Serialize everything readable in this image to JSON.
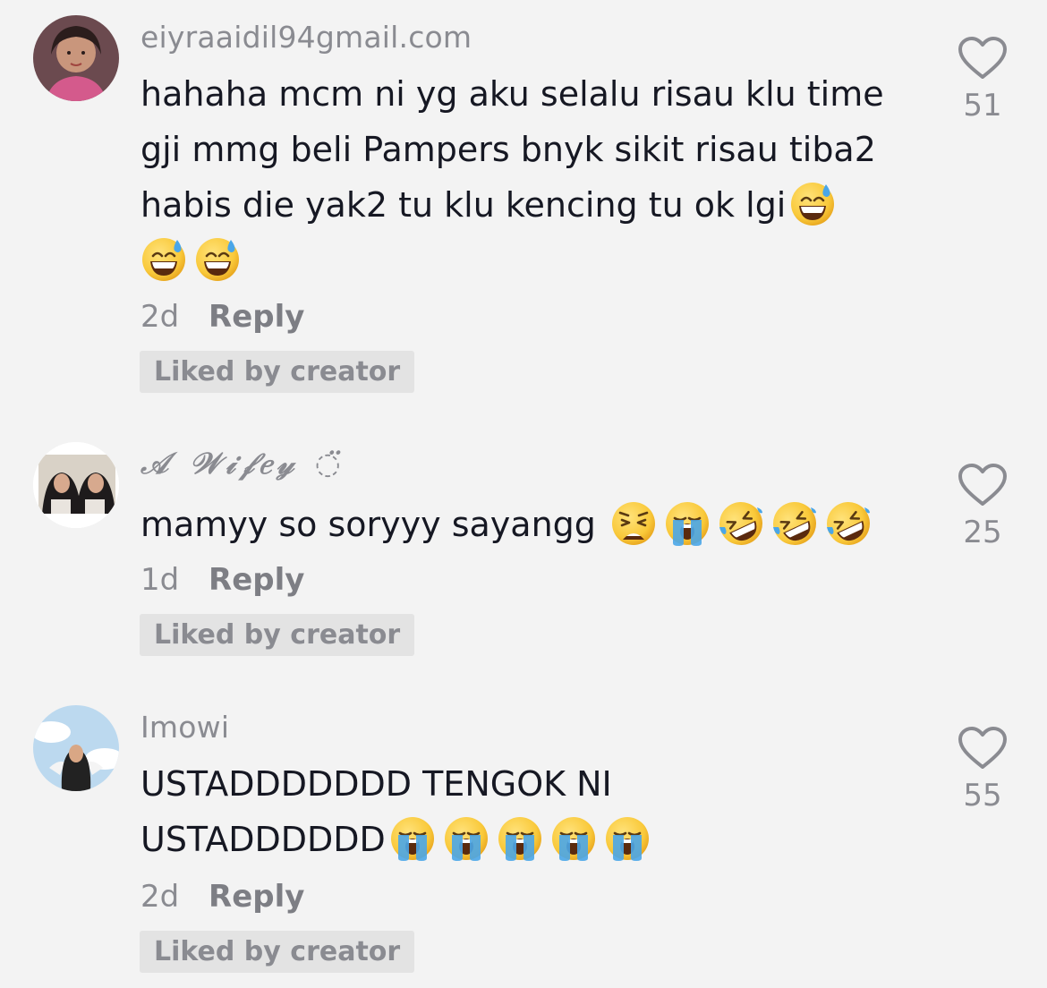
{
  "comments": [
    {
      "username": "eiyraaidil94gmail.com",
      "text_lines": [
        "hahaha mcm ni yg aku selalu risau klu time",
        "gji mmg beli Pampers bnyk sikit risau tiba2",
        "habis die yak2 tu klu kencing tu ok lgi"
      ],
      "emojis": [
        "grinning-sweat-emoji",
        "grinning-sweat-emoji",
        "grinning-sweat-emoji"
      ],
      "time": "2d",
      "reply_label": "Reply",
      "badge": "Liked by creator",
      "likes": "51"
    },
    {
      "username": "𝒜 𝒲𝒾𝒻𝑒𝓎 ◌̈",
      "text": "mamyy so soryyy sayangg",
      "emojis": [
        "weary-face-emoji",
        "loudly-crying-emoji",
        "rofl-emoji",
        "rofl-emoji",
        "rofl-emoji"
      ],
      "time": "1d",
      "reply_label": "Reply",
      "badge": "Liked by creator",
      "likes": "25"
    },
    {
      "username": "Imowi",
      "text_lines": [
        "USTADDDDDDD TENGOK NI",
        "USTADDDDDD"
      ],
      "emojis": [
        "loudly-crying-emoji",
        "loudly-crying-emoji",
        "loudly-crying-emoji",
        "loudly-crying-emoji",
        "loudly-crying-emoji"
      ],
      "time": "2d",
      "reply_label": "Reply",
      "badge": "Liked by creator",
      "likes": "55"
    }
  ],
  "colors": {
    "background": "#f3f3f3",
    "text": "#161823",
    "muted": "#8a8b91",
    "badge_bg": "#e3e3e3",
    "emoji_yellow": "#f9c93a",
    "tear_blue": "#4aa6e8"
  }
}
